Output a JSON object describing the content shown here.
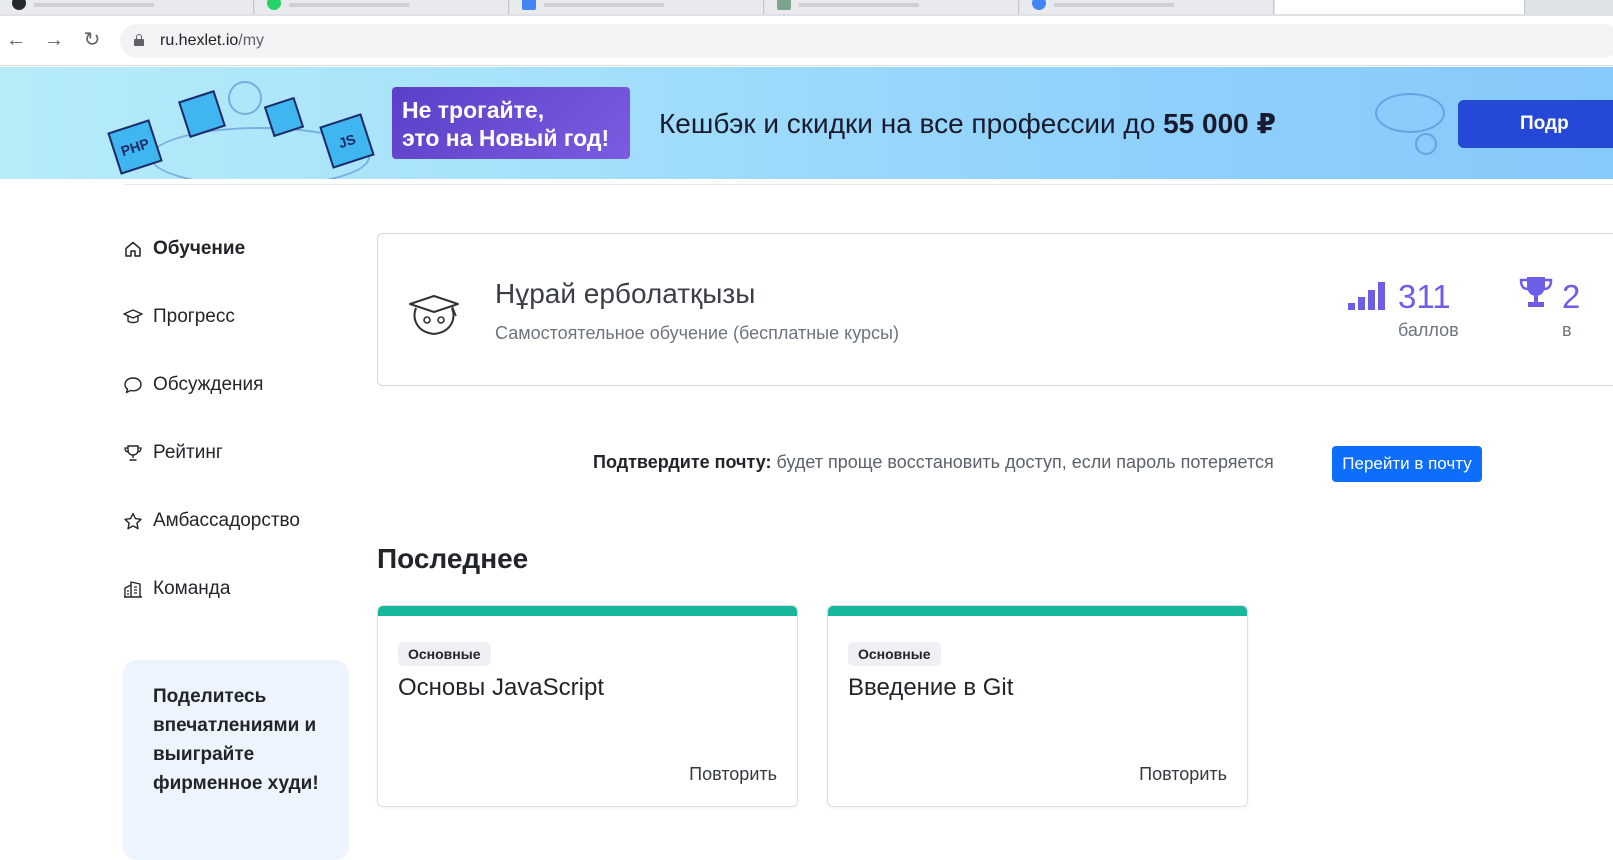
{
  "browser": {
    "url_host": "ru.hexlet.io",
    "url_path": "/my"
  },
  "banner": {
    "cubes": [
      "PHP",
      "JS"
    ],
    "promo_line1": "Не трогайте,",
    "promo_line2": "это на Новый год!",
    "headline": "Кешбэк и скидки на все профессии до ",
    "headline_amount": "55 000 ₽",
    "cta": "Подр"
  },
  "sidebar": {
    "items": [
      {
        "label": "Обучение",
        "icon": "home-icon"
      },
      {
        "label": "Прогресс",
        "icon": "graduation-cap-icon"
      },
      {
        "label": "Обсуждения",
        "icon": "chat-bubble-icon"
      },
      {
        "label": "Рейтинг",
        "icon": "trophy-icon"
      },
      {
        "label": "Амбассадорство",
        "icon": "star-icon"
      },
      {
        "label": "Команда",
        "icon": "building-icon"
      }
    ],
    "share_text": "Поделитесь впечатлениями и выиграйте фирменное худи!"
  },
  "profile": {
    "name": "Нұрай ерболатқызы",
    "plan": "Самостоятельное обучение (бесплатные курсы)",
    "points_value": "311",
    "points_label": "баллов",
    "rank_value": "2",
    "rank_label": "в"
  },
  "verify": {
    "label": "Подтвердите почту:",
    "text": " будет проще восстановить доступ, если пароль потеряется",
    "button": "Перейти в почту"
  },
  "recent": {
    "title": "Последнее",
    "courses": [
      {
        "badge": "Основные",
        "title": "Основы JavaScript",
        "action": "Повторить"
      },
      {
        "badge": "Основные",
        "title": "Введение в Git",
        "action": "Повторить"
      }
    ]
  },
  "colors": {
    "accent": "#0d6efd",
    "stats": "#6d5ee8",
    "course_stripe": "#17b79b"
  }
}
